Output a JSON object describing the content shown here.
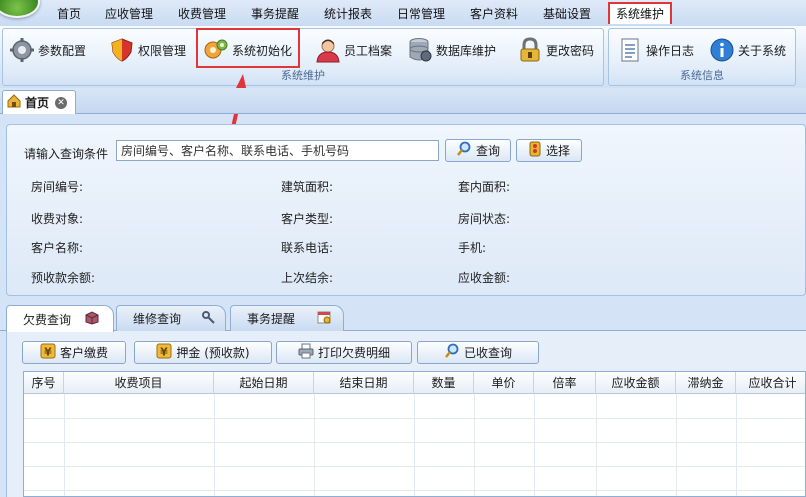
{
  "menu": {
    "items": [
      "首页",
      "应收管理",
      "收费管理",
      "事务提醒",
      "统计报表",
      "日常管理",
      "客户资料",
      "基础设置",
      "系统维护"
    ]
  },
  "ribbon": {
    "group1": {
      "label": "系统维护",
      "buttons": [
        "参数配置",
        "权限管理",
        "系统初始化",
        "员工档案",
        "数据库维护",
        "更改密码"
      ]
    },
    "group2": {
      "label": "系统信息",
      "buttons": [
        "操作日志",
        "关于系统"
      ]
    }
  },
  "tabs": {
    "home": "首页",
    "close_icon": "close-icon"
  },
  "query": {
    "label": "请输入查询条件",
    "placeholder": "房间编号、客户名称、联系电话、手机号码",
    "search_button": "查询",
    "select_button": "选择"
  },
  "fields": [
    "房间编号:",
    "建筑面积:",
    "套内面积:",
    "收费对象:",
    "客户类型:",
    "房间状态:",
    "客户名称:",
    "联系电话:",
    "手机:",
    "预收款余额:",
    "上次结余:",
    "应收金额:"
  ],
  "lower_tabs": [
    "欠费查询",
    "维修查询",
    "事务提醒"
  ],
  "actions": [
    "客户缴费",
    "押金 (预收款)",
    "打印欠费明细",
    "已收查询"
  ],
  "table": {
    "columns": [
      "序号",
      "收费项目",
      "起始日期",
      "结束日期",
      "数量",
      "单价",
      "倍率",
      "应收金额",
      "滞纳金",
      "应收合计"
    ],
    "rows": []
  },
  "colors": {
    "highlight": "#e2353a",
    "accent": "#c9dbf2"
  }
}
